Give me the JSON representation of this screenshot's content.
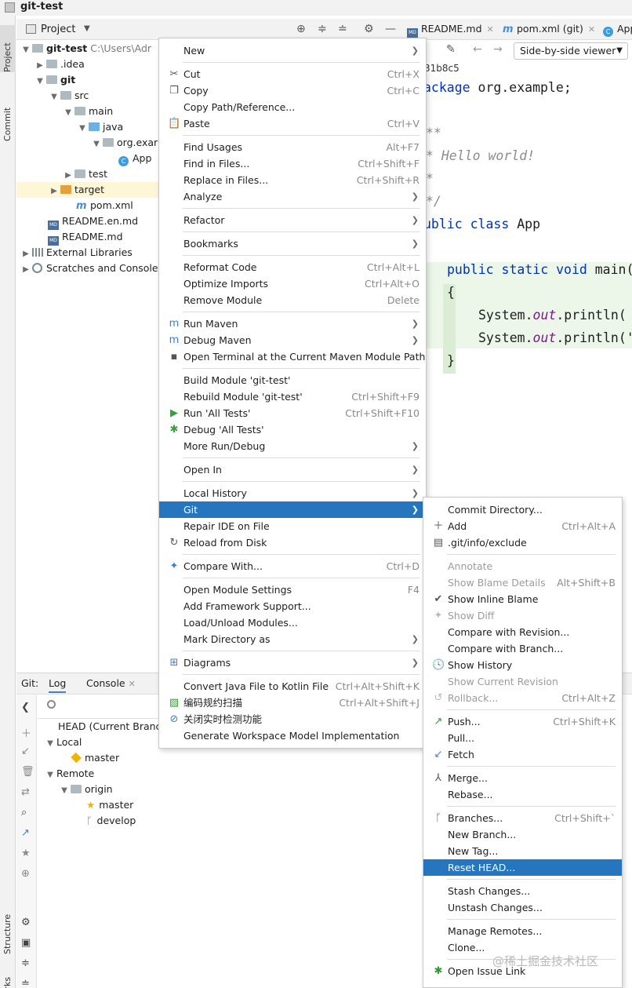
{
  "window": {
    "title": "git-test"
  },
  "left_strip": {
    "project": "Project",
    "commit": "Commit",
    "structure": "Structure",
    "bookmarks": "marks"
  },
  "project_header": {
    "label": "Project"
  },
  "tree": [
    {
      "label": "git-test",
      "path": "C:\\Users\\Adr"
    },
    {
      "label": ".idea"
    },
    {
      "label": "git"
    },
    {
      "label": "src"
    },
    {
      "label": "main"
    },
    {
      "label": "java"
    },
    {
      "label": "org.exar"
    },
    {
      "label": "App"
    },
    {
      "label": "test"
    },
    {
      "label": "target"
    },
    {
      "label": "pom.xml"
    },
    {
      "label": "README.en.md"
    },
    {
      "label": "README.md"
    },
    {
      "label": "External Libraries"
    },
    {
      "label": "Scratches and Consoles"
    }
  ],
  "editor": {
    "tabs": [
      "README.md",
      "pom.xml (git)",
      "App"
    ],
    "viewer": "Side-by-side viewer",
    "revision": "31b8c5",
    "code": {
      "l1_kw": "ackage",
      "l1_rest": " org.example;",
      "l2": "**",
      "l3": "* Hello world!",
      "l4": "*",
      "l5": "*/",
      "l6_kw": "ublic class",
      "l6_rest": " App",
      "l7_kw": "public static void",
      "l7_rest": " main(",
      "l8": "{",
      "l9_a": "System.",
      "l9_b": "out",
      "l9_c": ".println(",
      "l10_a": "System.",
      "l10_b": "out",
      "l10_c": ".println('",
      "l11": "}"
    }
  },
  "bottom": {
    "tabs": [
      "Git:",
      "Log",
      "Console"
    ],
    "branches": [
      {
        "label": "HEAD (Current Branch"
      },
      {
        "label": "Local"
      },
      {
        "label": "master"
      },
      {
        "label": "Remote"
      },
      {
        "label": "origin"
      },
      {
        "label": "master"
      },
      {
        "label": "develop"
      }
    ]
  },
  "main_menu": [
    {
      "label": "New",
      "shortcut": "",
      "sub": true
    },
    {
      "label": "Cut",
      "shortcut": "Ctrl+X"
    },
    {
      "label": "Copy",
      "shortcut": "Ctrl+C"
    },
    {
      "label": "Copy Path/Reference...",
      "shortcut": ""
    },
    {
      "label": "Paste",
      "shortcut": "Ctrl+V"
    },
    {
      "label": "Find Usages",
      "shortcut": "Alt+F7"
    },
    {
      "label": "Find in Files...",
      "shortcut": "Ctrl+Shift+F"
    },
    {
      "label": "Replace in Files...",
      "shortcut": "Ctrl+Shift+R"
    },
    {
      "label": "Analyze",
      "shortcut": "",
      "sub": true
    },
    {
      "label": "Refactor",
      "shortcut": "",
      "sub": true
    },
    {
      "label": "Bookmarks",
      "shortcut": "",
      "sub": true
    },
    {
      "label": "Reformat Code",
      "shortcut": "Ctrl+Alt+L"
    },
    {
      "label": "Optimize Imports",
      "shortcut": "Ctrl+Alt+O"
    },
    {
      "label": "Remove Module",
      "shortcut": "Delete"
    },
    {
      "label": "Run Maven",
      "shortcut": "",
      "sub": true
    },
    {
      "label": "Debug Maven",
      "shortcut": "",
      "sub": true
    },
    {
      "label": "Open Terminal at the Current Maven Module Path",
      "shortcut": ""
    },
    {
      "label": "Build Module 'git-test'",
      "shortcut": ""
    },
    {
      "label": "Rebuild Module 'git-test'",
      "shortcut": "Ctrl+Shift+F9"
    },
    {
      "label": "Run 'All Tests'",
      "shortcut": "Ctrl+Shift+F10"
    },
    {
      "label": "Debug 'All Tests'",
      "shortcut": ""
    },
    {
      "label": "More Run/Debug",
      "shortcut": "",
      "sub": true
    },
    {
      "label": "Open In",
      "shortcut": "",
      "sub": true
    },
    {
      "label": "Local History",
      "shortcut": "",
      "sub": true
    },
    {
      "label": "Git",
      "shortcut": "",
      "sub": true
    },
    {
      "label": "Repair IDE on File",
      "shortcut": ""
    },
    {
      "label": "Reload from Disk",
      "shortcut": ""
    },
    {
      "label": "Compare With...",
      "shortcut": "Ctrl+D"
    },
    {
      "label": "Open Module Settings",
      "shortcut": "F4"
    },
    {
      "label": "Add Framework Support...",
      "shortcut": ""
    },
    {
      "label": "Load/Unload Modules...",
      "shortcut": ""
    },
    {
      "label": "Mark Directory as",
      "shortcut": "",
      "sub": true
    },
    {
      "label": "Diagrams",
      "shortcut": "",
      "sub": true
    },
    {
      "label": "Convert Java File to Kotlin File",
      "shortcut": "Ctrl+Alt+Shift+K"
    },
    {
      "label": "编码规约扫描",
      "shortcut": "Ctrl+Alt+Shift+J"
    },
    {
      "label": "关闭实时检测功能",
      "shortcut": ""
    },
    {
      "label": "Generate Workspace Model Implementation",
      "shortcut": ""
    }
  ],
  "git_menu": [
    {
      "label": "Commit Directory...",
      "shortcut": ""
    },
    {
      "label": "Add",
      "shortcut": "Ctrl+Alt+A"
    },
    {
      "label": ".git/info/exclude",
      "shortcut": ""
    },
    {
      "label": "Annotate",
      "shortcut": ""
    },
    {
      "label": "Show Blame Details",
      "shortcut": "Alt+Shift+B"
    },
    {
      "label": "Show Inline Blame",
      "shortcut": ""
    },
    {
      "label": "Show Diff",
      "shortcut": ""
    },
    {
      "label": "Compare with Revision...",
      "shortcut": ""
    },
    {
      "label": "Compare with Branch...",
      "shortcut": ""
    },
    {
      "label": "Show History",
      "shortcut": ""
    },
    {
      "label": "Show Current Revision",
      "shortcut": ""
    },
    {
      "label": "Rollback...",
      "shortcut": "Ctrl+Alt+Z"
    },
    {
      "label": "Push...",
      "shortcut": "Ctrl+Shift+K"
    },
    {
      "label": "Pull...",
      "shortcut": ""
    },
    {
      "label": "Fetch",
      "shortcut": ""
    },
    {
      "label": "Merge...",
      "shortcut": ""
    },
    {
      "label": "Rebase...",
      "shortcut": ""
    },
    {
      "label": "Branches...",
      "shortcut": "Ctrl+Shift+`"
    },
    {
      "label": "New Branch...",
      "shortcut": ""
    },
    {
      "label": "New Tag...",
      "shortcut": ""
    },
    {
      "label": "Reset HEAD...",
      "shortcut": ""
    },
    {
      "label": "Stash Changes...",
      "shortcut": ""
    },
    {
      "label": "Unstash Changes...",
      "shortcut": ""
    },
    {
      "label": "Manage Remotes...",
      "shortcut": ""
    },
    {
      "label": "Clone...",
      "shortcut": ""
    },
    {
      "label": "Open Issue Link",
      "shortcut": ""
    }
  ],
  "watermark": "@稀土掘金技术社区",
  "colors": {
    "selection": "#2675bf",
    "diff_added": "#ecf6e9",
    "keyword": "#0033b3"
  }
}
